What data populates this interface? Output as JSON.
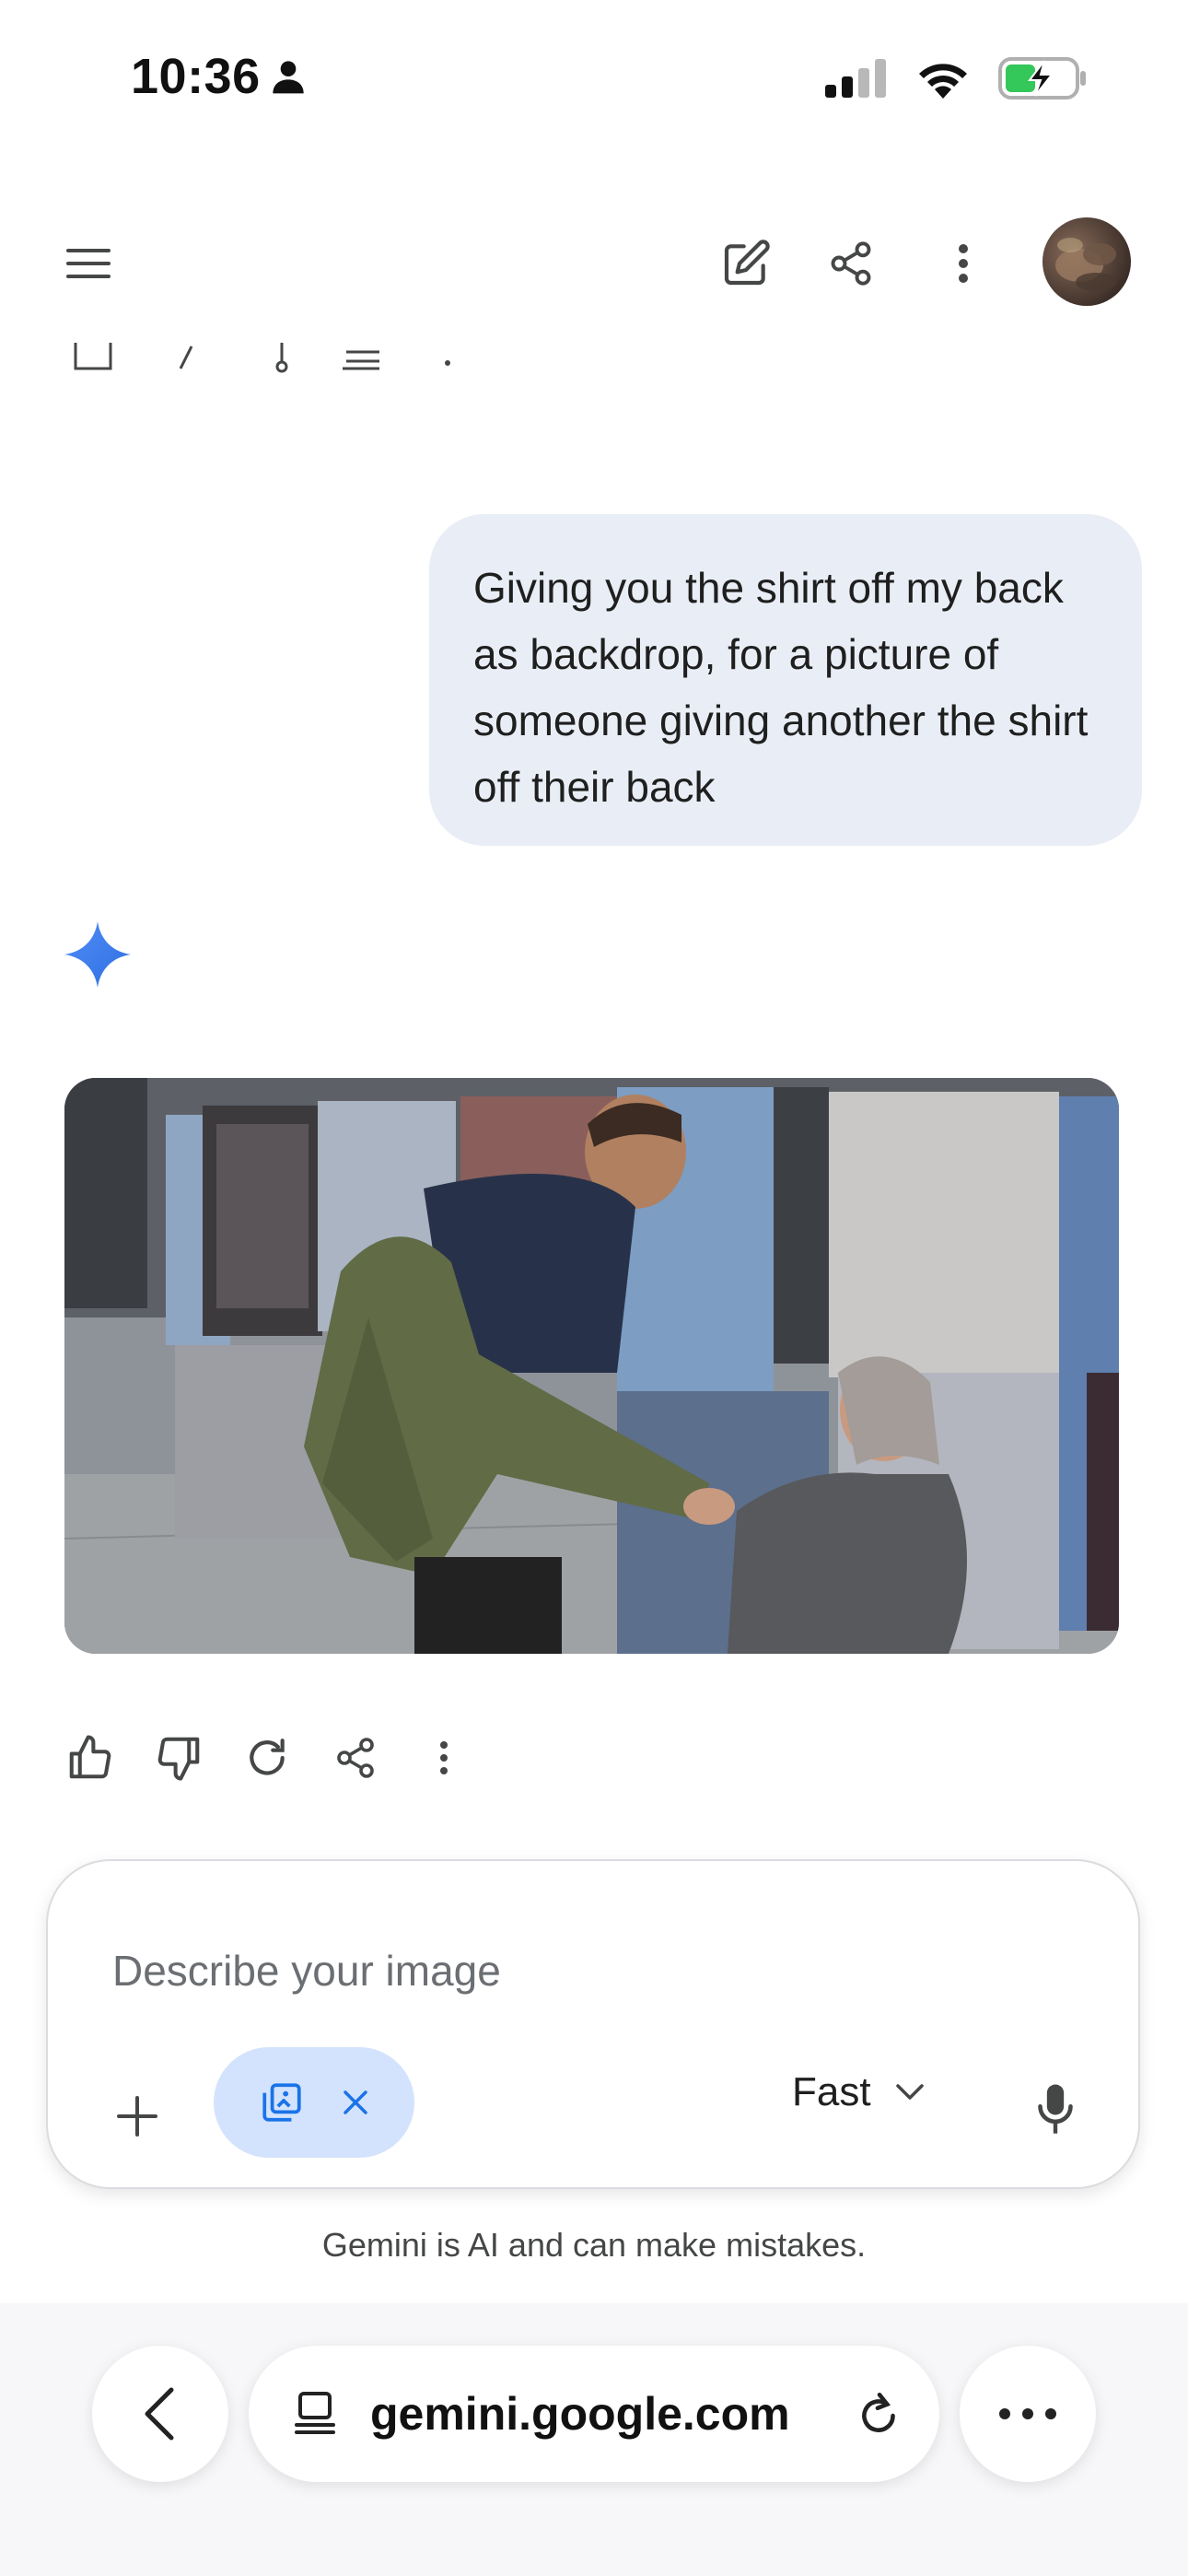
{
  "status_bar": {
    "time": "10:36",
    "icons": [
      "person-icon",
      "cellular-signal-icon",
      "wifi-icon",
      "battery-charging-icon"
    ]
  },
  "app_bar": {
    "icons": [
      "menu-icon",
      "edit-icon",
      "share-icon",
      "more-vert-icon"
    ],
    "avatar": "avatar"
  },
  "conversation": {
    "user_message": "Giving you the shirt off my back as backdrop, for a picture of someone giving another the shirt off their back",
    "response_icon": "gemini-spark-icon",
    "generated_image": "generated-image",
    "actions": [
      "thumbs-up-icon",
      "thumbs-down-icon",
      "regenerate-icon",
      "share-icon",
      "more-vert-icon"
    ]
  },
  "composer": {
    "placeholder": "Describe your image",
    "tool_chip_icon": "image-gen-icon",
    "mode_label": "Fast",
    "mode_icon": "chevron-down-icon",
    "mic_icon": "mic-icon"
  },
  "disclaimer": "Gemini is AI and can make mistakes.",
  "browser": {
    "url": "gemini.google.com",
    "icons": [
      "back-icon",
      "tabs-icon",
      "reload-icon",
      "more-horiz-icon"
    ]
  },
  "colors": {
    "bubble": "#e9eef6",
    "chip": "#d3e3fd",
    "accent": "#1a73e8",
    "spark": "#4285f4"
  }
}
